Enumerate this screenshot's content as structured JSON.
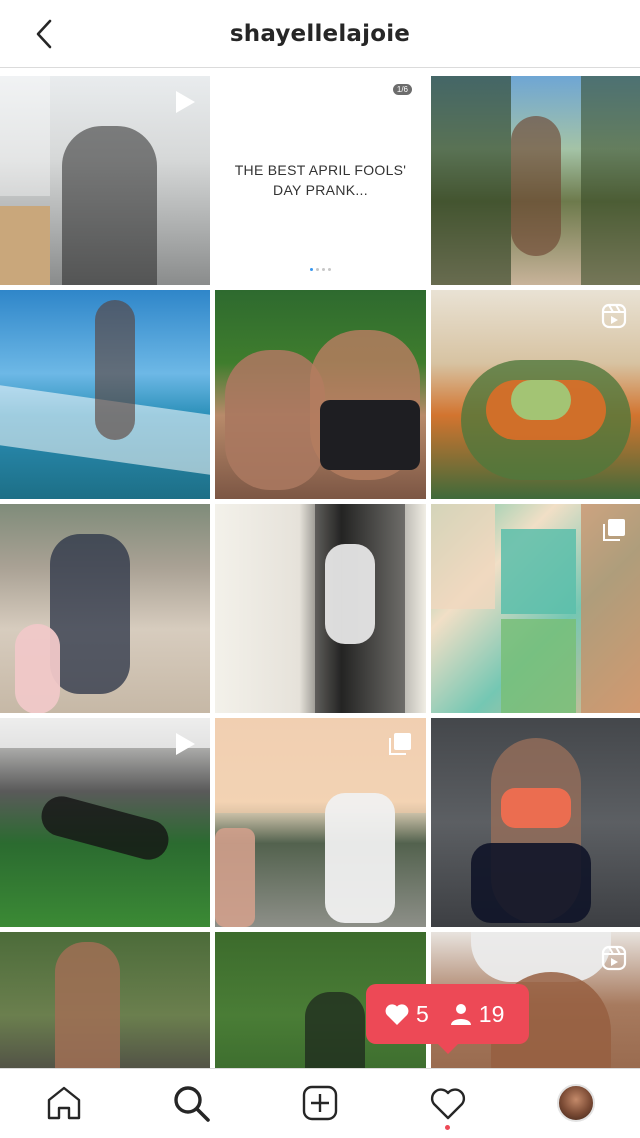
{
  "header": {
    "back_icon": "chevron-left-icon",
    "username": "shayellelajoie"
  },
  "grid": {
    "posts": [
      {
        "type": "video",
        "icon": "play-icon"
      },
      {
        "type": "carousel",
        "counter": "1/6",
        "text": "THE BEST APRIL FOOLS' DAY PRANK..."
      },
      {
        "type": "photo"
      },
      {
        "type": "photo"
      },
      {
        "type": "photo"
      },
      {
        "type": "reel",
        "icon": "reels-icon"
      },
      {
        "type": "photo"
      },
      {
        "type": "photo"
      },
      {
        "type": "carousel",
        "icon": "multiple-photos-icon"
      },
      {
        "type": "video",
        "icon": "play-icon"
      },
      {
        "type": "carousel",
        "icon": "multiple-photos-icon"
      },
      {
        "type": "photo"
      },
      {
        "type": "photo"
      },
      {
        "type": "photo"
      },
      {
        "type": "reel",
        "icon": "reels-icon"
      }
    ]
  },
  "notification": {
    "likes": "5",
    "follows": "19",
    "color": "#ed4956"
  },
  "bottom_nav": {
    "items": [
      {
        "name": "home",
        "icon": "home-icon"
      },
      {
        "name": "search",
        "icon": "search-icon"
      },
      {
        "name": "new-post",
        "icon": "plus-square-icon"
      },
      {
        "name": "activity",
        "icon": "heart-icon"
      },
      {
        "name": "profile",
        "icon": "avatar"
      }
    ]
  }
}
